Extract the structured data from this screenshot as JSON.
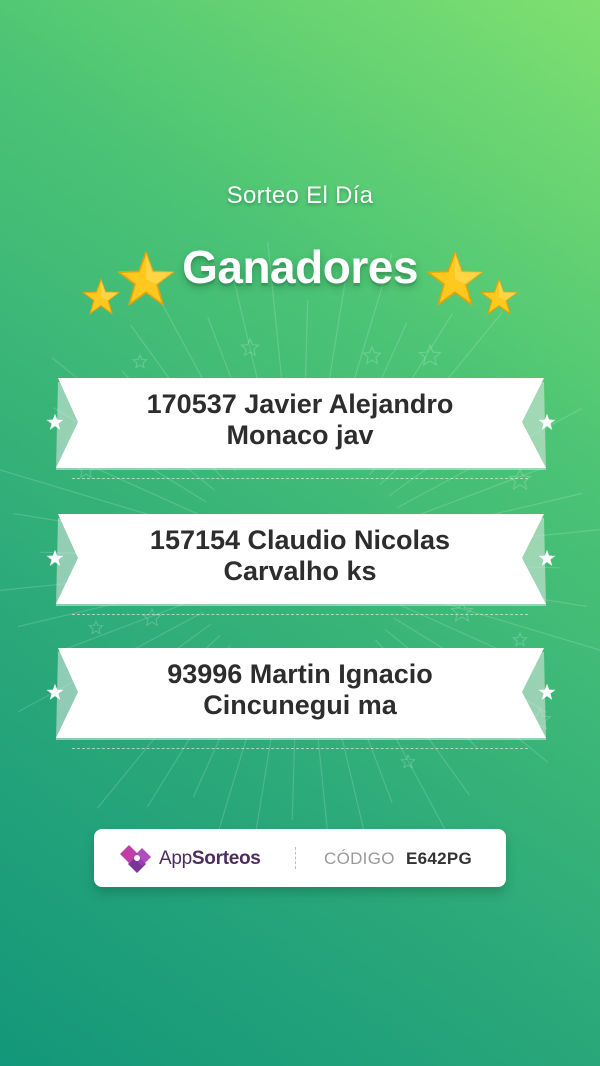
{
  "header": {
    "subtitle": "Sorteo El Día",
    "title": "Ganadores"
  },
  "winners": [
    {
      "line1": "170537 Javier Alejandro",
      "line2": "Monaco jav"
    },
    {
      "line1": "157154 Claudio Nicolas",
      "line2": "Carvalho ks"
    },
    {
      "line1": "93996 Martin Ignacio",
      "line2": "Cincunegui ma"
    }
  ],
  "footer": {
    "brand_part1": "App",
    "brand_part2": "Sorteos",
    "code_label": "CÓDIGO",
    "code_value": "E642PG"
  },
  "icons": [
    "star-icon",
    "appsorteos-logo-icon"
  ],
  "colors": {
    "background_top": "#7fe070",
    "background_bottom": "#13977a",
    "star_gold": "#ffcc22",
    "ribbon": "#ffffff",
    "brand_purple": "#4d2c5e"
  }
}
